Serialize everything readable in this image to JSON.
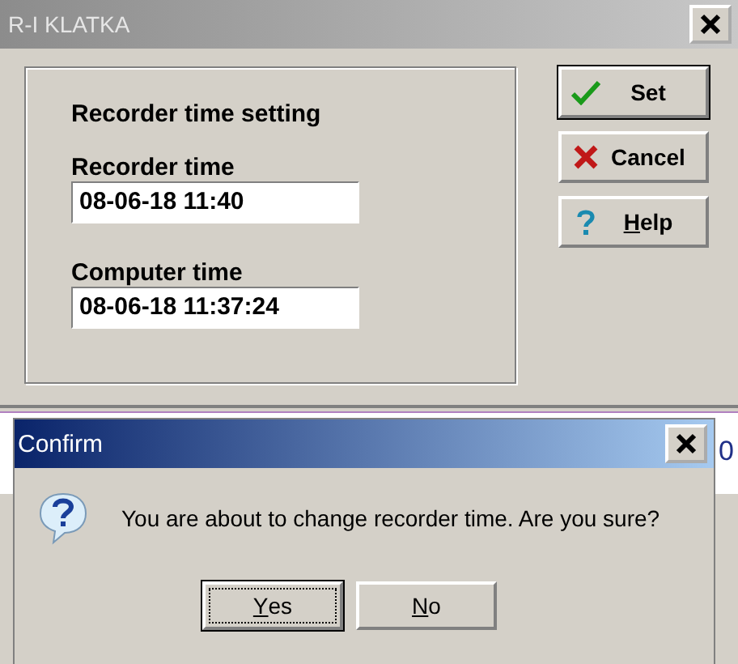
{
  "window": {
    "title": "R-I KLATKA"
  },
  "group": {
    "heading": "Recorder time setting",
    "fields": [
      {
        "label": "Recorder time",
        "value": "08-06-18 11:40"
      },
      {
        "label": "Computer time",
        "value": "08-06-18 11:37:24"
      }
    ]
  },
  "buttons": [
    {
      "kind": "check",
      "rest": "Set",
      "default": true
    },
    {
      "kind": "cross",
      "rest": "Cancel",
      "default": false
    },
    {
      "kind": "help",
      "key": "H",
      "rest": "elp",
      "default": false
    }
  ],
  "background_text": "0",
  "confirm": {
    "title": "Confirm",
    "message": "You are about to change recorder time. Are you sure?",
    "buttons": [
      {
        "key": "Y",
        "rest": "es",
        "focused": true
      },
      {
        "key": "N",
        "rest": "o",
        "focused": false
      }
    ]
  }
}
